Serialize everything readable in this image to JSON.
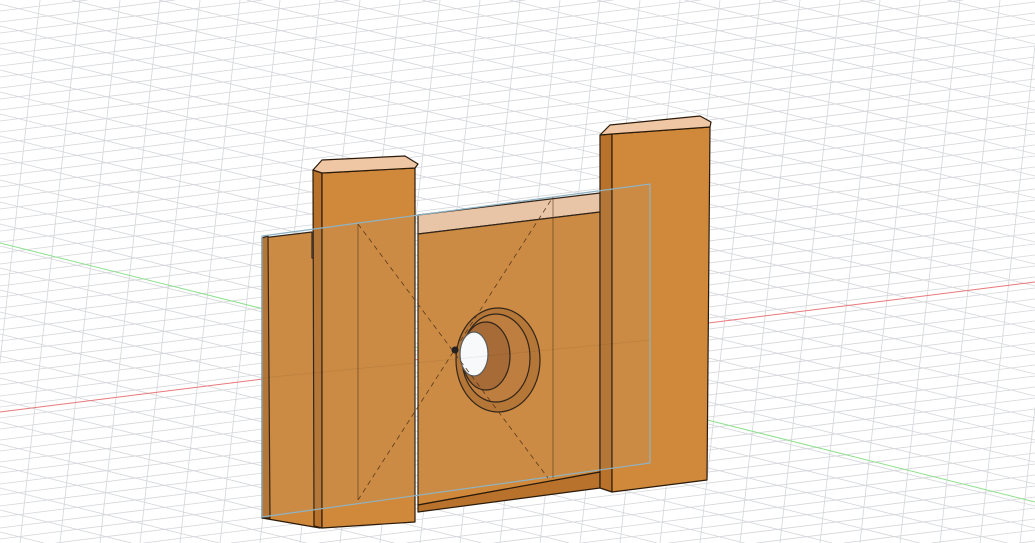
{
  "viewport": {
    "background_color": "#ffffff",
    "grid_color": "#d4d6da",
    "x_axis_color": "#e8787a",
    "y_axis_color": "#8ee08e",
    "sketch_outline_color": "#8fb3c4"
  },
  "model": {
    "body_color": "#d0883a",
    "body_shadow_color": "#b8722c",
    "body_highlight_color": "#f0c7a4",
    "edge_color": "#2a1a0a",
    "hole_icon": "counterbore-hole-icon",
    "origin_icon": "origin-point-icon"
  }
}
